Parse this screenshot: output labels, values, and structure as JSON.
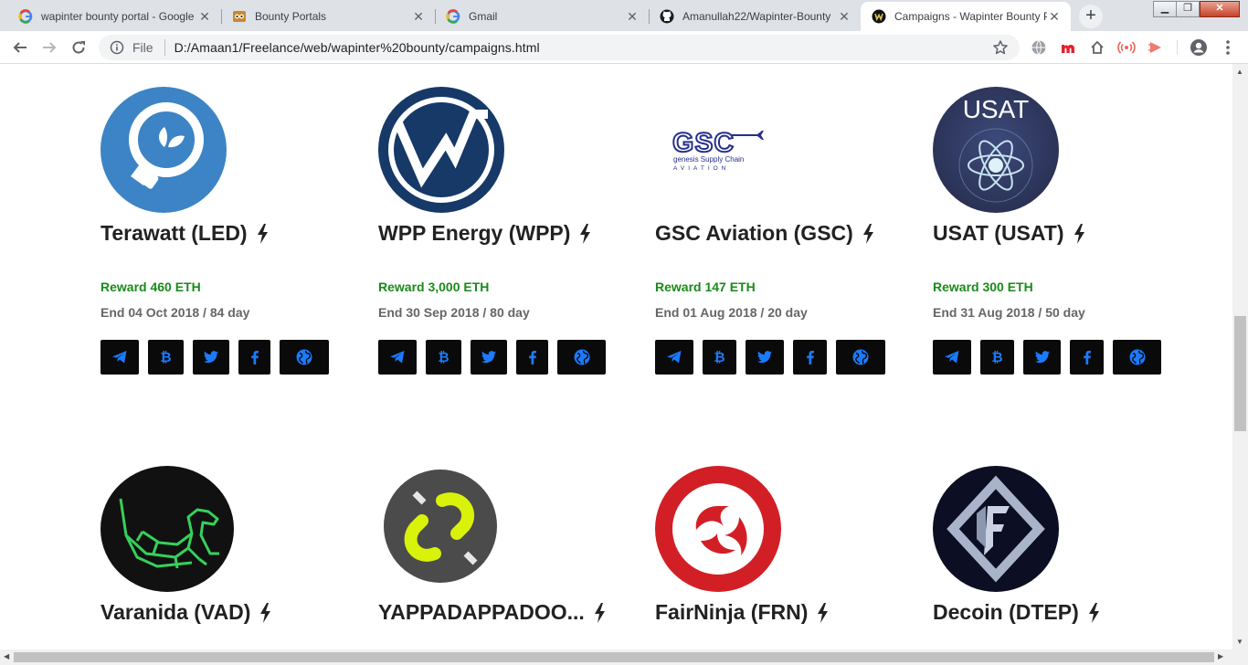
{
  "browser": {
    "tabs": [
      {
        "title": "wapinter bounty portal - Google",
        "icon": "google-icon"
      },
      {
        "title": "Bounty Portals",
        "icon": "bounty-portals-icon"
      },
      {
        "title": "Gmail",
        "icon": "google-icon"
      },
      {
        "title": "Amanullah22/Wapinter-Bounty",
        "icon": "github-icon"
      },
      {
        "title": "Campaigns - Wapinter Bounty P",
        "icon": "wapinter-icon",
        "active": true
      }
    ],
    "address": {
      "scheme_label": "File",
      "url": "D:/Amaan1/Freelance/web/wapinter%20bounty/campaigns.html"
    }
  },
  "campaigns": [
    {
      "name": "Terawatt (LED)",
      "reward": "Reward 460 ETH",
      "end": "End 04 Oct 2018 / 84 day",
      "logo": "terawatt-logo"
    },
    {
      "name": "WPP Energy (WPP)",
      "reward": "Reward 3,000 ETH",
      "end": "End 30 Sep 2018 / 80 day",
      "logo": "wpp-logo"
    },
    {
      "name": "GSC Aviation (GSC)",
      "reward": "Reward 147 ETH",
      "end": "End 01 Aug 2018 / 20 day",
      "logo": "gsc-logo",
      "logo_text": {
        "main": "GSC",
        "sub": "genesis Supply Chain",
        "sub2": "AVIATION"
      }
    },
    {
      "name": "USAT (USAT)",
      "reward": "Reward 300 ETH",
      "end": "End 31 Aug 2018 / 50 day",
      "logo": "usat-logo",
      "logo_text": {
        "main": "USAT"
      }
    },
    {
      "name": "Varanida (VAD)",
      "logo": "varanida-logo"
    },
    {
      "name": "YAPPADAPPADOO...",
      "logo": "yappadappadoo-logo"
    },
    {
      "name": "FairNinja (FRN)",
      "logo": "fairninja-logo"
    },
    {
      "name": "Decoin (DTEP)",
      "logo": "decoin-logo"
    }
  ],
  "social_icons": [
    "telegram-icon",
    "bitcoin-icon",
    "twitter-icon",
    "facebook-icon",
    "globe-icon"
  ],
  "colors": {
    "reward": "#1a8a1a",
    "social_icon": "#1a7bff",
    "social_bg": "#0a0a0a"
  }
}
